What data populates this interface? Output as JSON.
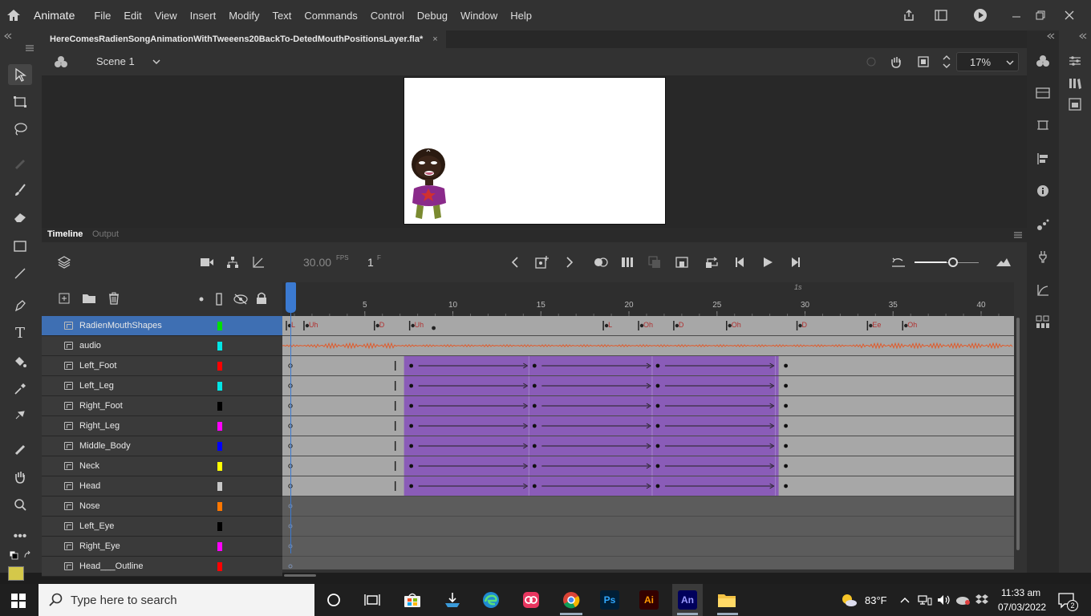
{
  "app": {
    "name": "Animate"
  },
  "menu": [
    "File",
    "Edit",
    "View",
    "Insert",
    "Modify",
    "Text",
    "Commands",
    "Control",
    "Debug",
    "Window",
    "Help"
  ],
  "document": {
    "tab_title": "HereComesRadienSongAnimationWithTweeens20BackTo-DetedMouthPositionsLayer.fla*",
    "close_glyph": "×"
  },
  "scene": {
    "name": "Scene 1",
    "zoom": "17%"
  },
  "timeline": {
    "tabs": [
      "Timeline",
      "Output"
    ],
    "fps": "30.00",
    "fps_unit": "FPS",
    "frame": "1",
    "frame_unit": "F",
    "ruler_label": "1s",
    "ruler_ticks": [
      "5",
      "10",
      "15",
      "20",
      "25",
      "30",
      "35",
      "40"
    ]
  },
  "layers": [
    {
      "name": "RadienMouthShapes",
      "color": "#00e000",
      "selected": true
    },
    {
      "name": "audio",
      "color": "#00e5e5"
    },
    {
      "name": "Left_Foot",
      "color": "#ff0000"
    },
    {
      "name": "Left_Leg",
      "color": "#00e5e5"
    },
    {
      "name": "Right_Foot",
      "color": "#000000"
    },
    {
      "name": "Right_Leg",
      "color": "#ff00ff"
    },
    {
      "name": "Middle_Body",
      "color": "#0000ff"
    },
    {
      "name": "Neck",
      "color": "#ffff00"
    },
    {
      "name": "Head",
      "color": "#c8c8c8"
    },
    {
      "name": "Nose",
      "color": "#ff7700"
    },
    {
      "name": "Left_Eye",
      "color": "#000000"
    },
    {
      "name": "Right_Eye",
      "color": "#ff00ff"
    },
    {
      "name": "Head___Outline",
      "color": "#ff0000"
    }
  ],
  "mouth_labels": [
    "L",
    "Uh",
    "D",
    "Uh",
    "L",
    "Oh",
    "D",
    "Oh",
    "D",
    "Ee",
    "Oh"
  ],
  "taskbar": {
    "search_placeholder": "Type here to search",
    "ps_label": "Ps",
    "ai_label": "Ai",
    "an_label": "An",
    "weather": "83°F",
    "time": "11:33 am",
    "date": "07/03/2022",
    "notif_count": "2"
  },
  "colors": {
    "accent": "#3e6fb3",
    "tween": "#8a5cb8",
    "fill_swatch": "#d4c84a"
  }
}
